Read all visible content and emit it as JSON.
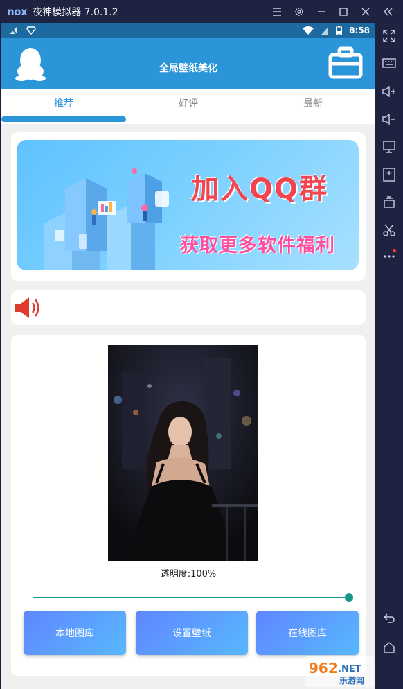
{
  "emulator": {
    "logo": "nox",
    "title": "夜神模拟器 7.0.1.2",
    "controls": [
      "menu-icon",
      "settings-icon",
      "minimize-icon",
      "maximize-icon",
      "close-icon",
      "collapse-icon"
    ],
    "side_tools": [
      "fullscreen-icon",
      "keyboard-icon",
      "volume-up-icon",
      "volume-down-icon",
      "screen-icon",
      "install-apk-icon",
      "multi-instance-icon",
      "screenshot-cut-icon",
      "more-icon",
      "back-icon",
      "home-icon"
    ]
  },
  "status_bar": {
    "time": "8:58",
    "icons": [
      "no-signal-icon",
      "vpn-icon",
      "wifi-icon",
      "sim-icon",
      "battery-icon"
    ]
  },
  "app_bar": {
    "title": "全局壁纸美化",
    "left_icon": "qq-penguin-icon",
    "right_icon": "toolbox-icon"
  },
  "tabs": [
    {
      "label": "推荐",
      "active": true
    },
    {
      "label": "好评",
      "active": false
    },
    {
      "label": "最新",
      "active": false
    }
  ],
  "banner": {
    "headline": "加入QQ群",
    "subline": "获取更多软件福利"
  },
  "notice": {
    "icon": "speaker-icon"
  },
  "wallpaper": {
    "opacity_label": "透明度:100%",
    "opacity_value": 1.0
  },
  "buttons": {
    "local": "本地图库",
    "set": "设置壁纸",
    "online": "在线图库"
  },
  "watermark": "962.NET 乐游网",
  "colors": {
    "primary": "#2b95da",
    "status_bar": "#1d6aa1",
    "slider": "#18968a",
    "emulator_chrome": "#1f2342",
    "banner_headline": "#f1454f",
    "banner_subline": "#ff4f9f"
  }
}
